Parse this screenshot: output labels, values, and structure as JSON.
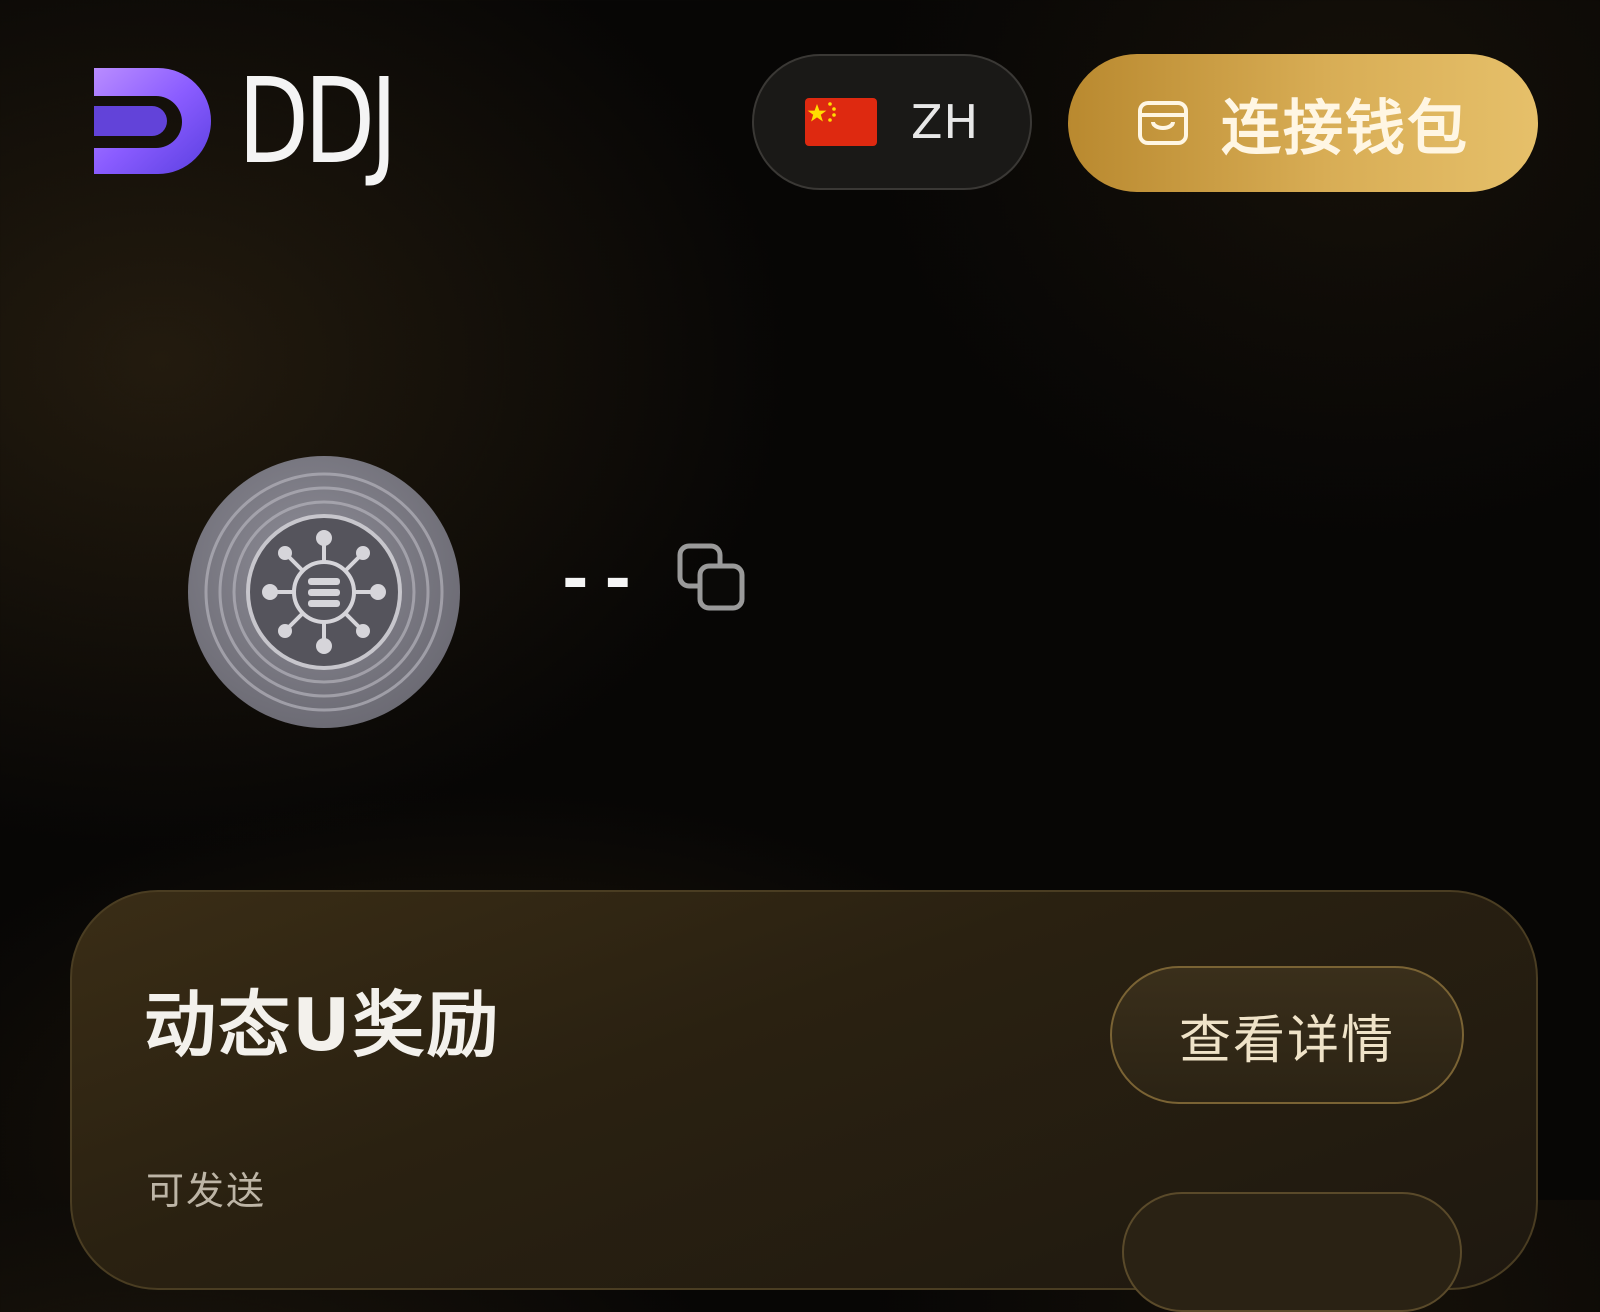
{
  "header": {
    "logo_text": "DDJ",
    "language": {
      "code": "ZH",
      "flag_icon": "china-flag-icon"
    },
    "connect_wallet": {
      "label": "连接钱包",
      "icon": "wallet-icon"
    }
  },
  "account": {
    "avatar_icon": "network-coin-icon",
    "address": "--",
    "copy_icon": "copy-icon"
  },
  "reward_card": {
    "title": "动态U奖励",
    "details_button": "查看详情",
    "sendable_label": "可发送"
  },
  "colors": {
    "background": "#070605",
    "gold_accent": "#d8ad55",
    "logo_gradient_start": "#7f5cff",
    "logo_gradient_end": "#c57dff",
    "card_background": "#2a2111",
    "card_border": "#4a3d22"
  }
}
